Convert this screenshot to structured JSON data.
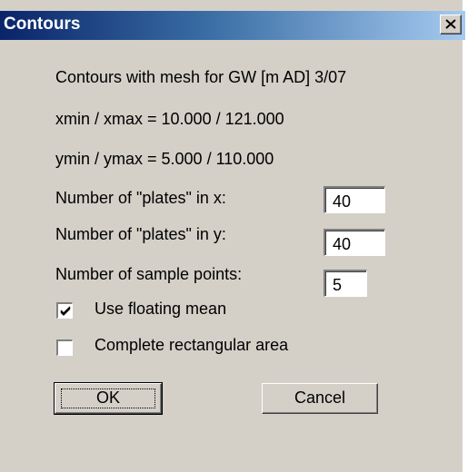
{
  "dialog": {
    "title": "Contours",
    "info": {
      "heading": "Contours with mesh for GW [m AD] 3/07",
      "x_range": "xmin / xmax =  10.000 / 121.000",
      "y_range": "ymin / ymax =  5.000 / 110.000"
    },
    "fields": {
      "plates_x": {
        "label": "Number of \"plates\" in x:",
        "value": "40"
      },
      "plates_y": {
        "label": "Number of \"plates\" in y:",
        "value": "40"
      },
      "sample_points": {
        "label": "Number of sample points:",
        "value": "5"
      }
    },
    "checkboxes": {
      "floating_mean": {
        "label": "Use floating mean",
        "checked": true
      },
      "complete_rect": {
        "label": "Complete rectangular area",
        "checked": false
      }
    },
    "buttons": {
      "ok": "OK",
      "cancel": "Cancel"
    },
    "icons": {
      "close": "close-icon",
      "check": "checkmark-icon"
    }
  }
}
